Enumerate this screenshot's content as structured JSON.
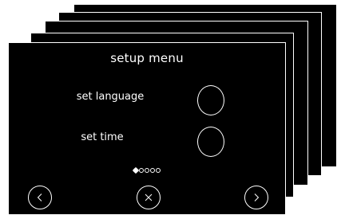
{
  "screen": {
    "title": "setup menu",
    "background": "#000000",
    "foreground": "#ffffff"
  },
  "rows": [
    {
      "label": "set language",
      "selected": false
    },
    {
      "label": "set time",
      "selected": false
    }
  ],
  "pager": {
    "total": 5,
    "current": 1
  },
  "nav": {
    "prev_icon": "chevron-left-icon",
    "close_icon": "close-icon",
    "next_icon": "chevron-right-icon"
  }
}
